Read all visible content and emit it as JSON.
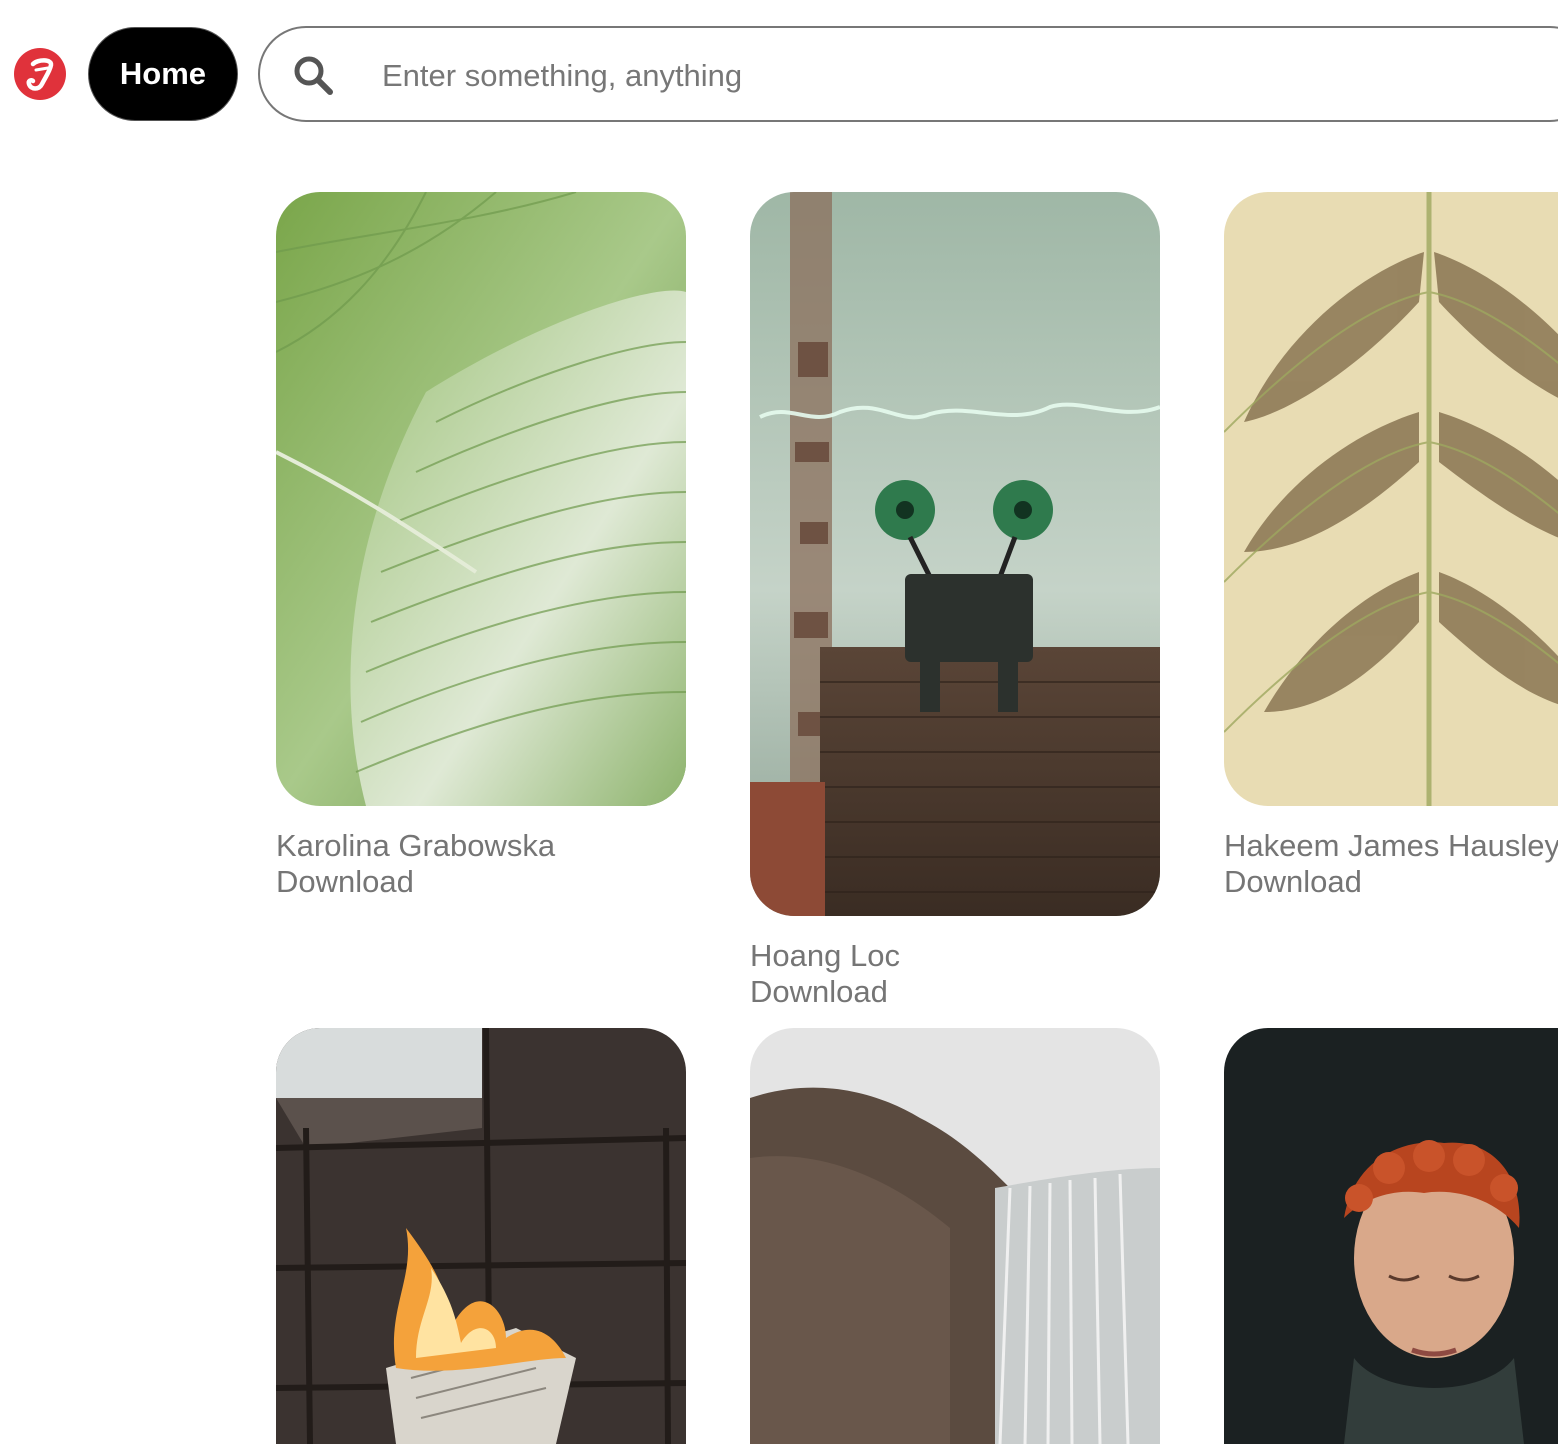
{
  "header": {
    "home_label": "Home",
    "search_placeholder": "Enter something, anything"
  },
  "pins": [
    {
      "author": "Karolina Grabowska",
      "download": "Download"
    },
    {
      "author": "Hoang Loc",
      "download": "Download"
    },
    {
      "author": "Hakeem James Hausley",
      "download": "Download"
    },
    {
      "author": "",
      "download": ""
    },
    {
      "author": "",
      "download": ""
    },
    {
      "author": "",
      "download": ""
    }
  ],
  "colors": {
    "logo": "#e0323b",
    "home_bg": "#000000",
    "meta_text": "#757575"
  }
}
